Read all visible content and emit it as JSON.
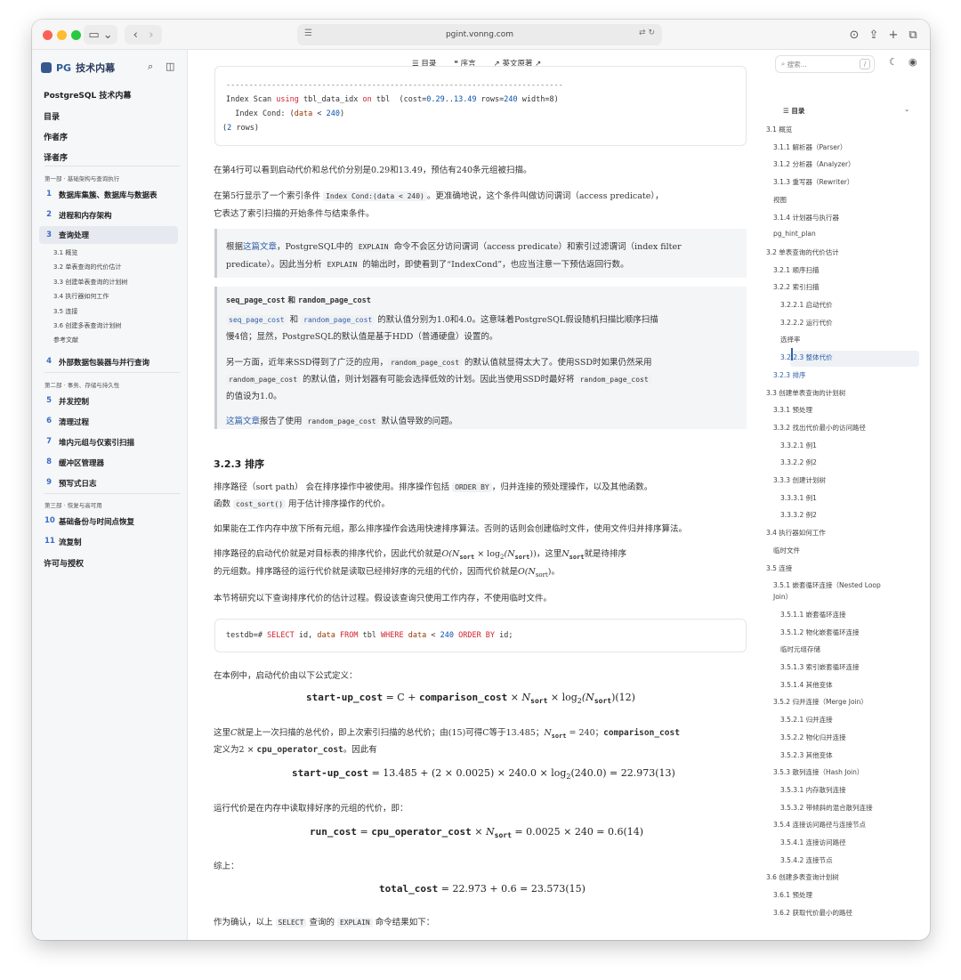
{
  "browser": {
    "url": "pgint.vonng.com"
  },
  "sidebar": {
    "brand_prefix": "PG",
    "brand_text": "技术内幕",
    "top_items": [
      "PostgreSQL 技术内幕",
      "目录",
      "作者序",
      "译者序"
    ],
    "part1": "第一部 · 基础架构与查询执行",
    "ch1": {
      "n": "1",
      "label": "数据库集簇、数据库与数据表"
    },
    "ch2": {
      "n": "2",
      "label": "进程和内存架构"
    },
    "ch3": {
      "n": "3",
      "label": "查询处理"
    },
    "ch3_subs": [
      "3.1 概览",
      "3.2 单表查询的代价估计",
      "3.3 创建单表查询的计划树",
      "3.4 执行器如何工作",
      "3.5 连接",
      "3.6 创建多表查询计划树",
      "参考文献"
    ],
    "ch4": {
      "n": "4",
      "label": "外部数据包装器与并行查询"
    },
    "part2": "第二部 · 事务、存储与持久性",
    "ch5": {
      "n": "5",
      "label": "并发控制"
    },
    "ch6": {
      "n": "6",
      "label": "清理过程"
    },
    "ch7": {
      "n": "7",
      "label": "堆内元组与仅索引扫描"
    },
    "ch8": {
      "n": "8",
      "label": "缓冲区管理器"
    },
    "ch9": {
      "n": "9",
      "label": "预写式日志"
    },
    "part3": "第三部 · 恢复与高可用",
    "ch10": {
      "n": "10",
      "label": "基础备份与时间点恢复"
    },
    "ch11": {
      "n": "11",
      "label": "流复制"
    },
    "license": "许可与授权"
  },
  "topnav": {
    "toc": "目录",
    "preface": "序言",
    "english": "英文原著",
    "search_placeholder": "搜索...",
    "search_key": "/"
  },
  "code1": {
    "line2_a": "Index Scan ",
    "line2_kw1": "using",
    "line2_b": " tbl_data_idx ",
    "line2_kw2": "on",
    "line2_c": " tbl  (cost=",
    "line2_n1": "0.29",
    "line2_d": "..",
    "line2_n2": "13.49",
    "line2_e": " rows=",
    "line2_n3": "240",
    "line2_f": " width=8)",
    "line3_a": "  Index Cond: (",
    "line3_id": "data",
    "line3_b": " < ",
    "line3_n": "240",
    "line3_c": ")",
    "line4_a": "(",
    "line4_n": "2",
    "line4_b": " rows)"
  },
  "p1": "在第4行可以看到启动代价和总代价分别是0.29和13.49，预估有240条元组被扫描。",
  "p2": {
    "a": "在第5行显示了一个索引条件 ",
    "code": "Index Cond:(data < 240)",
    "b": "。更准确地说，这个条件叫做访问谓词（access predicate），",
    "c": "它表达了索引扫描的开始条件与结束条件。"
  },
  "callout1": {
    "a": "根据",
    "link": "这篇文章",
    "b": "，PostgreSQL中的 ",
    "code": "EXPLAIN",
    "c": " 命令不会区分访问谓词（access predicate）和索引过滤谓词（index filter",
    "d": "predicate）。因此当分析 ",
    "code2": "EXPLAIN",
    "e": " 的输出时，即使看到了“IndexCond”，也应当注意一下预估返回行数。"
  },
  "callout2": {
    "title_a": "seq_page_cost",
    "title_b": " 和 ",
    "title_c": "random_page_cost",
    "p1_code1": "seq_page_cost",
    "p1_a": " 和 ",
    "p1_code2": "random_page_cost",
    "p1_b": " 的默认值分别为1.0和4.0。这意味着PostgreSQL假设随机扫描比顺序扫描",
    "p1_c": "慢4倍；显然，PostgreSQL的默认值是基于HDD（普通硬盘）设置的。",
    "p2_a": "另一方面，近年来SSD得到了广泛的应用，",
    "p2_code": "random_page_cost",
    "p2_b": " 的默认值就显得太大了。使用SSD时如果仍然采用",
    "p2_code2": "random_page_cost",
    "p2_c": " 的默认值，则计划器有可能会选择低效的计划。因此当使用SSD时最好将 ",
    "p2_code3": "random_page_cost",
    "p2_d": "的值设为1.0。",
    "p3_link": "这篇文章",
    "p3_a": "报告了使用 ",
    "p3_code": "random_page_cost",
    "p3_b": " 默认值导致的问题。"
  },
  "h_sort": "3.2.3 排序",
  "p3": {
    "a": "排序路径（sort path） 会在排序操作中被使用。排序操作包括 ",
    "code": "ORDER BY",
    "b": "，归并连接的预处理操作，以及其他函数。",
    "c": "函数 ",
    "code2": "cost_sort()",
    "d": " 用于估计排序操作的代价。"
  },
  "p4": "如果能在工作内存中放下所有元组，那么排序操作会选用快速排序算法。否则的话则会创建临时文件，使用文件归并排序算法。",
  "p5": {
    "a": "排序路径的启动代价就是对目标表的排序代价，因此代价就是",
    "m1": "O(N",
    "m1s": "sort",
    "m1b": " × log",
    "m1c": "2",
    "m1d": "(N",
    "m1e": "sort",
    "m1f": "))",
    "b": "，这里",
    "m2": "N",
    "m2s": "sort",
    "c": "就是待排序",
    "d": "的元组数。排序路径的运行代价就是读取已经排好序的元组的代价，因而代价就是",
    "m3": "O(N",
    "m3s": "sort",
    "m3b": ")",
    "e": "。"
  },
  "p6": "本节将研究以下查询排序代价的估计过程。假设该查询只使用工作内存，不使用临时文件。",
  "code2": {
    "prompt": "testdb=# ",
    "kw1": "SELECT",
    "a": " id, ",
    "id": "data",
    "kw2": " FROM",
    "b": " tbl ",
    "kw3": "WHERE",
    "c": " ",
    "id2": "data",
    "d": " < ",
    "n": "240",
    "e": " ",
    "kw4": "ORDER BY",
    "f": " id;"
  },
  "p7": "在本例中，启动代价由以下公式定义：",
  "eq1": {
    "a": "start-up_cost",
    "b": " = C + ",
    "c": "comparison_cost",
    "d": " × N",
    "ds": "sort",
    "e": " × log",
    "es": "2",
    "f": "(N",
    "fs": "sort",
    "g": ")(12)"
  },
  "p8": {
    "a": "这里",
    "m": "C",
    "b": "就是上一次扫描的总代价，即上次索引扫描的总代价；由(15)可得C等于13.485；",
    "m2": "N",
    "m2s": "sort",
    "m2b": " = 240；",
    "c": "comparison_cost",
    "d": "定义为2 × ",
    "e": "cpu_operator_cost",
    "f": "。因此有"
  },
  "eq2": {
    "a": "start-up_cost",
    "b": " = 13.485 + (2 × 0.0025) × 240.0 × log",
    "bs": "2",
    "c": "(240.0) = 22.973(13)"
  },
  "p9": "运行代价是在内存中读取排好序的元组的代价，即：",
  "eq3": {
    "a": "run_cost",
    "b": " = ",
    "c": "cpu_operator_cost",
    "d": " × N",
    "ds": "sort",
    "e": " = 0.0025 × 240 = 0.6(14)"
  },
  "p10": "综上：",
  "eq4": {
    "a": "total_cost",
    "b": " = 22.973 + 0.6 = 23.573(15)"
  },
  "p11": {
    "a": "作为确认，以上 ",
    "code": "SELECT",
    "b": " 查询的 ",
    "code2": "EXPLAIN",
    "c": " 命令结果如下："
  },
  "toc": {
    "title": "目录",
    "items": [
      "3.1 概览",
      "3.1.1 解析器（Parser）",
      "3.1.2 分析器（Analyzer）",
      "3.1.3 重写器（Rewriter）",
      "视图",
      "3.1.4 计划器与执行器",
      "pg_hint_plan",
      "3.2 单表查询的代价估计",
      "3.2.1 顺序扫描",
      "3.2.2 索引扫描",
      "3.2.2.1 启动代价",
      "3.2.2.2 运行代价",
      "选择率",
      "3.2.2.3 整体代价",
      "3.2.3 排序",
      "3.3 创建单表查询的计划树",
      "3.3.1 预处理",
      "3.3.2 找出代价最小的访问路径",
      "3.3.2.1 例1",
      "3.3.2.2 例2",
      "3.3.3 创建计划树",
      "3.3.3.1 例1",
      "3.3.3.2 例2",
      "3.4 执行器如何工作",
      "临时文件",
      "3.5 连接",
      "3.5.1 嵌套循环连接（Nested Loop",
      "Join）",
      "3.5.1.1 嵌套循环连接",
      "3.5.1.2 物化嵌套循环连接",
      "临时元组存储",
      "3.5.1.3 索引嵌套循环连接",
      "3.5.1.4 其他变体",
      "3.5.2 归并连接（Merge Join）",
      "3.5.2.1 归并连接",
      "3.5.2.2 物化归并连接",
      "3.5.2.3 其他变体",
      "3.5.3 散列连接（Hash Join）",
      "3.5.3.1 内存散列连接",
      "3.5.3.2 带倾斜的混合散列连接",
      "3.5.4 连接访问路径与连接节点",
      "3.5.4.1 连接访问路径",
      "3.5.4.2 连接节点",
      "3.6 创建多表查询计划树",
      "3.6.1 预处理",
      "3.6.2 获取代价最小的路径"
    ]
  }
}
